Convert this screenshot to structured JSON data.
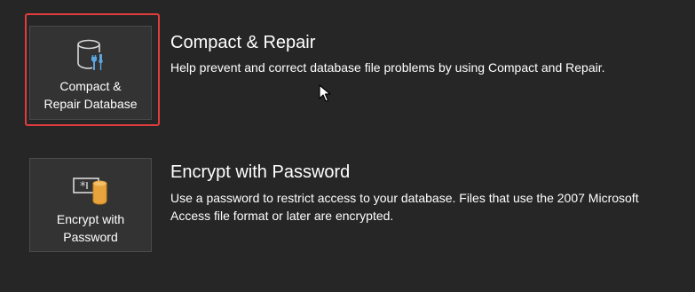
{
  "compact": {
    "tile_label": "Compact &\nRepair Database",
    "title": "Compact & Repair",
    "description": "Help prevent and correct database file problems by using Compact and Repair.",
    "icon": "database-wrench-icon"
  },
  "encrypt": {
    "tile_label": "Encrypt with\nPassword",
    "title": "Encrypt with Password",
    "description": "Use a password to restrict access to your database. Files that use the 2007 Microsoft Access file format or later are encrypted.",
    "icon": "password-database-icon"
  },
  "colors": {
    "background": "#262626",
    "tile": "#333333",
    "highlight": "#e03c3c",
    "icon_blue": "#5aa7e0",
    "icon_orange": "#e8a33d"
  },
  "cursor": "arrow-cursor-icon"
}
